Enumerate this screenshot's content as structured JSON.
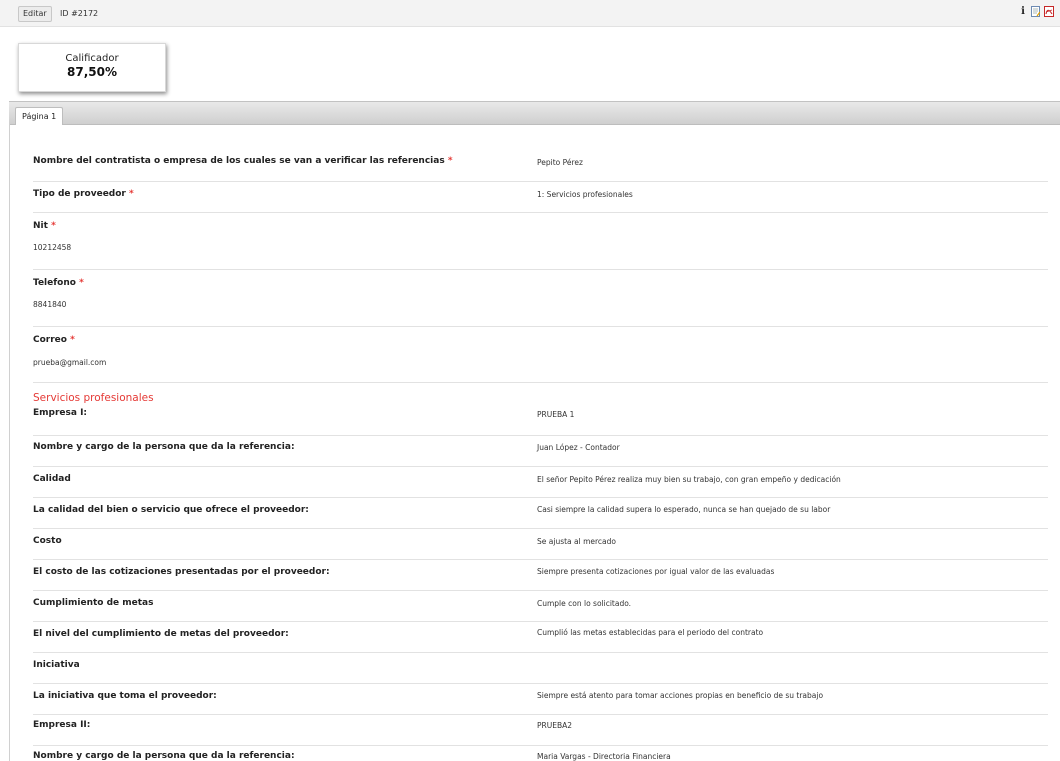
{
  "toolbar": {
    "edit_label": "Editar",
    "record_id": "ID #2172",
    "icons": [
      "info-icon",
      "edit-document-icon",
      "pdf-icon"
    ]
  },
  "score": {
    "label": "Calificador",
    "value": "87,50%"
  },
  "tabs": [
    {
      "label": "Página 1"
    }
  ],
  "required_mark": "*",
  "colors": {
    "required": "#e53935",
    "section": "#e53935"
  },
  "fields": [
    {
      "label": "Nombre del contratista o empresa de los cuales se van a verificar las referencias",
      "value": "Pepito Pérez",
      "required": true
    },
    {
      "label": "Tipo de proveedor",
      "value": "1: Servicios profesionales",
      "required": true
    },
    {
      "label": "Nit",
      "value": "10212458",
      "required": true
    },
    {
      "label": "Telefono",
      "value": "8841840",
      "required": true
    },
    {
      "label": "Correo",
      "value": "prueba@gmail.com",
      "required": true
    }
  ],
  "section_title": "Servicios profesionales",
  "section_fields": [
    {
      "label": "Empresa I:",
      "value": "PRUEBA 1"
    },
    {
      "label": "Nombre y cargo de la persona que da la referencia:",
      "value": "Juan López - Contador"
    },
    {
      "label": "Calidad",
      "value": "El señor Pepito Pérez realiza muy bien su trabajo, con gran empeño y dedicación"
    },
    {
      "label": "La calidad del bien o servicio que ofrece el proveedor:",
      "value": "Casi siempre la calidad supera lo esperado, nunca se han quejado de su labor"
    },
    {
      "label": "Costo",
      "value": "Se ajusta al mercado"
    },
    {
      "label": "El costo de las cotizaciones presentadas por el proveedor:",
      "value": "Siempre presenta cotizaciones por igual valor de las evaluadas"
    },
    {
      "label": "Cumplimiento de metas",
      "value": "Cumple con lo solicitado."
    },
    {
      "label": "El nivel del cumplimiento de metas del proveedor:",
      "value": "Cumplió las metas establecidas para el periodo del contrato"
    },
    {
      "label": "Iniciativa",
      "value": ""
    },
    {
      "label": "La iniciativa que toma el proveedor:",
      "value": "Siempre está atento para tomar acciones propias en beneficio de su trabajo"
    },
    {
      "label": "Empresa II:",
      "value": "PRUEBA2"
    },
    {
      "label": "Nombre y cargo de la persona que da la referencia:",
      "value": "Maria Vargas - Directoria Financiera"
    }
  ]
}
